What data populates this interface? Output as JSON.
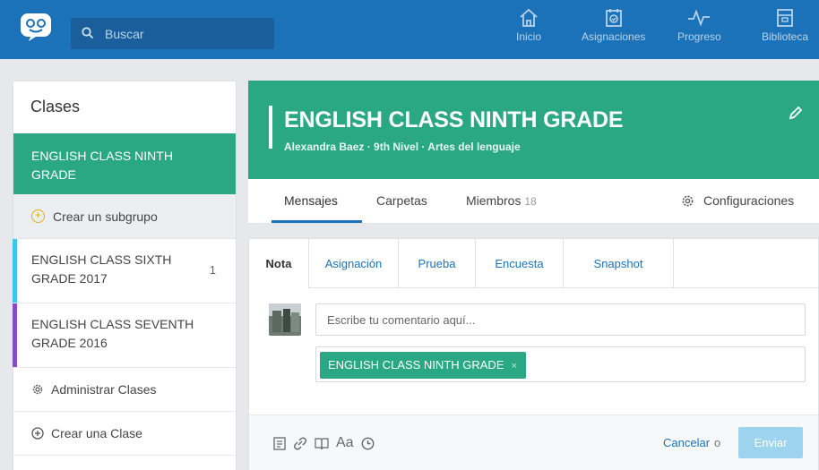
{
  "topbar": {
    "search_placeholder": "Buscar",
    "nav": [
      {
        "label": "Inicio",
        "icon": "home-icon"
      },
      {
        "label": "Asignaciones",
        "icon": "assignments-icon"
      },
      {
        "label": "Progreso",
        "icon": "progress-icon"
      },
      {
        "label": "Biblioteca",
        "icon": "library-icon"
      }
    ]
  },
  "sidebar": {
    "title": "Clases",
    "active_class": "ENGLISH CLASS NINTH GRADE",
    "create_subgroup": "Crear un subgrupo",
    "classes": [
      {
        "name": "ENGLISH CLASS SIXTH GRADE 2017",
        "count": "1",
        "color": "#3cc6e8"
      },
      {
        "name": "ENGLISH CLASS SEVENTH GRADE 2016",
        "count": "",
        "color": "#8a4bc7"
      }
    ],
    "manage": "Administrar Clases",
    "create": "Crear una Clase"
  },
  "group": {
    "name": "ENGLISH CLASS NINTH GRADE",
    "meta": "Alexandra Baez · 9th Nivel · Artes del lenguaje"
  },
  "tabs": {
    "messages": "Mensajes",
    "folders": "Carpetas",
    "members": "Miembros",
    "members_count": "18",
    "settings": "Configuraciones"
  },
  "composer": {
    "tabs": [
      "Nota",
      "Asignación",
      "Prueba",
      "Encuesta",
      "Snapshot"
    ],
    "comment_placeholder": "Escribe tu comentario aquí...",
    "recipient": "ENGLISH CLASS NINTH GRADE",
    "font_label": "Aa",
    "cancel": "Cancelar",
    "or": "o",
    "send": "Enviar"
  },
  "colors": {
    "brand_blue": "#1c72b8",
    "group_green": "#2aa883",
    "send_disabled": "#9ed3f0"
  }
}
